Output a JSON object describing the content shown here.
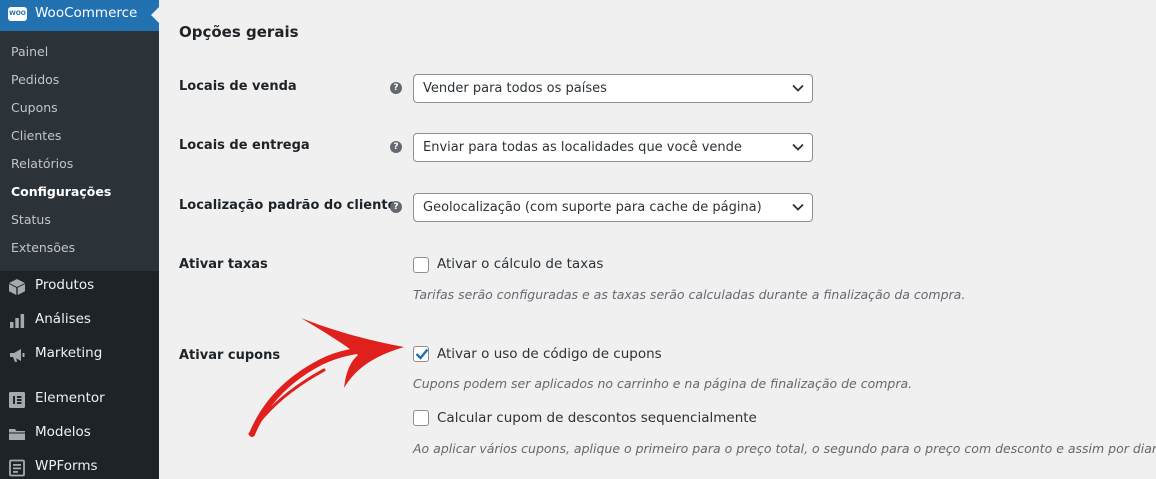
{
  "sidebar": {
    "plugin_title": "WooCommerce",
    "plugin_logo_text": "WOO",
    "submenu": [
      {
        "label": "Painel"
      },
      {
        "label": "Pedidos"
      },
      {
        "label": "Cupons"
      },
      {
        "label": "Clientes"
      },
      {
        "label": "Relatórios"
      },
      {
        "label": "Configurações",
        "active": true
      },
      {
        "label": "Status"
      },
      {
        "label": "Extensões"
      }
    ],
    "menu": [
      {
        "label": "Produtos",
        "icon": "box-icon"
      },
      {
        "label": "Análises",
        "icon": "bar-chart-icon"
      },
      {
        "label": "Marketing",
        "icon": "megaphone-icon"
      },
      {
        "label": "Elementor",
        "icon": "elementor-icon"
      },
      {
        "label": "Modelos",
        "icon": "folder-icon"
      },
      {
        "label": "WPForms",
        "icon": "forms-icon"
      }
    ]
  },
  "main": {
    "section_title": "Opções gerais",
    "selling_locations": {
      "label": "Locais de venda",
      "value": "Vender para todos os países"
    },
    "shipping_locations": {
      "label": "Locais de entrega",
      "value": "Enviar para todas as localidades que você vende"
    },
    "default_location": {
      "label": "Localização padrão do cliente",
      "value": "Geolocalização (com suporte para cache de página)"
    },
    "taxes": {
      "label": "Ativar taxas",
      "checkbox_label": "Ativar o cálculo de taxas",
      "checked": false,
      "description": "Tarifas serão configuradas e as taxas serão calculadas durante a finalização da compra."
    },
    "coupons": {
      "label": "Ativar cupons",
      "checkbox_label": "Ativar o uso de código de cupons",
      "checked": true,
      "description": "Cupons podem ser aplicados no carrinho e na página de finalização de compra.",
      "sequential_label": "Calcular cupom de descontos sequencialmente",
      "sequential_checked": false,
      "sequential_description": "Ao aplicar vários cupons, aplique o primeiro para o preço total, o segundo para o preço com desconto e assim por diante."
    },
    "help_glyph": "?"
  },
  "colors": {
    "sidebar_bg": "#1d2327",
    "submenu_bg": "#2c3338",
    "accent": "#2271b1",
    "annotation_arrow": "#e0201c"
  }
}
